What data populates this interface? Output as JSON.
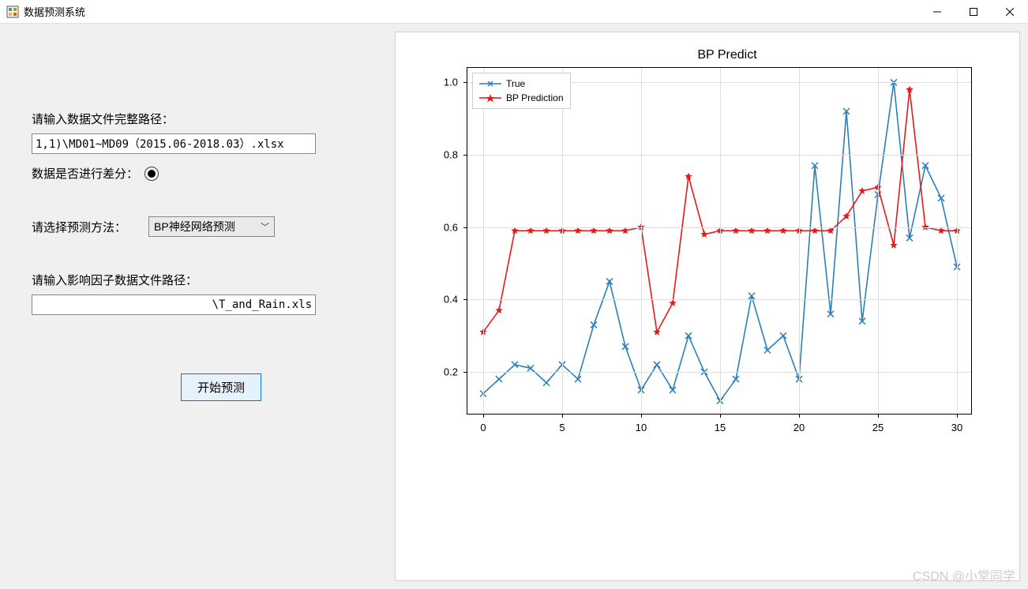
{
  "window": {
    "title": "数据预测系统"
  },
  "form": {
    "data_path_label": "请输入数据文件完整路径：",
    "data_path_value": "1,1)\\MD01~MD09（2015.06-2018.03）.xlsx",
    "diff_label": "数据是否进行差分：",
    "diff_checked": true,
    "method_label": "请选择预测方法：",
    "method_value": "BP神经网络预测",
    "factor_path_label": "请输入影响因子数据文件路径：",
    "factor_path_value": "\\T_and_Rain.xls",
    "predict_btn": "开始预测"
  },
  "watermark": "CSDN @小堂同学",
  "chart_data": {
    "type": "line",
    "title": "BP Predict",
    "xlabel": "",
    "ylabel": "",
    "xlim": [
      -1,
      31
    ],
    "ylim": [
      0.08,
      1.04
    ],
    "x_ticks": [
      0,
      5,
      10,
      15,
      20,
      25,
      30
    ],
    "y_ticks": [
      0.2,
      0.4,
      0.6,
      0.8,
      1.0
    ],
    "x": [
      0,
      1,
      2,
      3,
      4,
      5,
      6,
      7,
      8,
      9,
      10,
      11,
      12,
      13,
      14,
      15,
      16,
      17,
      18,
      19,
      20,
      21,
      22,
      23,
      24,
      25,
      26,
      27,
      28,
      29,
      30
    ],
    "series": [
      {
        "name": "True",
        "color": "#2c7fb8",
        "marker": "x",
        "values": [
          0.14,
          0.18,
          0.22,
          0.21,
          0.17,
          0.22,
          0.18,
          0.33,
          0.45,
          0.27,
          0.15,
          0.22,
          0.15,
          0.3,
          0.2,
          0.12,
          0.18,
          0.41,
          0.26,
          0.3,
          0.18,
          0.77,
          0.36,
          0.92,
          0.34,
          0.69,
          1.0,
          0.57,
          0.77,
          0.68,
          0.49
        ]
      },
      {
        "name": "BP Prediction",
        "color": "#e31a1c",
        "marker": "star",
        "values": [
          0.31,
          0.37,
          0.59,
          0.59,
          0.59,
          0.59,
          0.59,
          0.59,
          0.59,
          0.59,
          0.6,
          0.31,
          0.39,
          0.74,
          0.58,
          0.59,
          0.59,
          0.59,
          0.59,
          0.59,
          0.59,
          0.59,
          0.59,
          0.63,
          0.7,
          0.71,
          0.55,
          0.98,
          0.6,
          0.59,
          0.59
        ]
      }
    ],
    "legend_labels": [
      "True",
      "BP Prediction"
    ]
  }
}
